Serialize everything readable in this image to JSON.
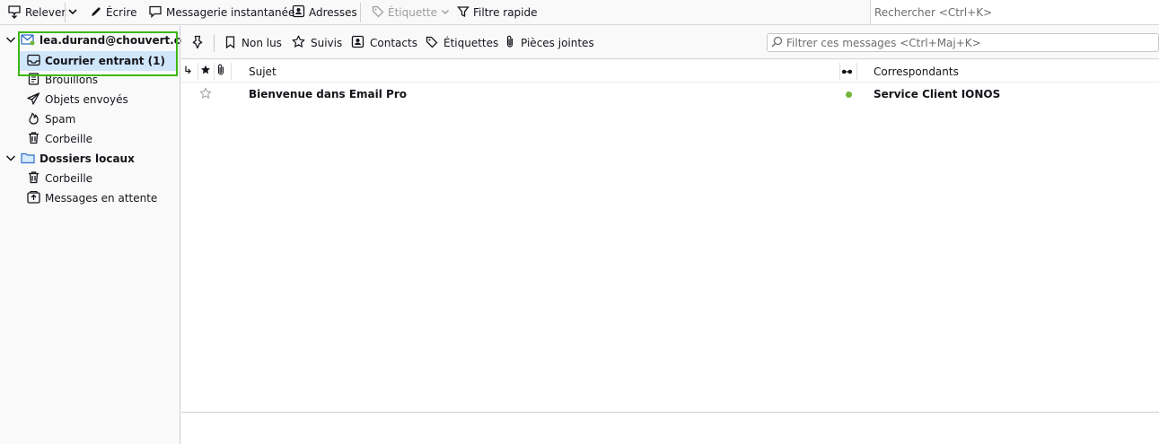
{
  "toolbar": {
    "get_messages": "Relever",
    "write": "Écrire",
    "chat": "Messagerie instantanée",
    "address_book": "Adresses",
    "tag": "Étiquette",
    "quick_filter": "Filtre rapide",
    "search_placeholder": "Rechercher <Ctrl+K>"
  },
  "folders": {
    "account": "lea.durand@chouvert.com",
    "inbox": "Courrier entrant (1)",
    "drafts": "Brouillons",
    "sent": "Objets envoyés",
    "spam": "Spam",
    "trash": "Corbeille",
    "local_folders": "Dossiers locaux",
    "local_trash": "Corbeille",
    "outbox": "Messages en attente"
  },
  "quick_filter_bar": {
    "unread": "Non lus",
    "starred": "Suivis",
    "contacts": "Contacts",
    "tags": "Étiquettes",
    "attachments": "Pièces jointes",
    "filter_placeholder": "Filtrer ces messages <Ctrl+Maj+K>"
  },
  "thread_header": {
    "subject": "Sujet",
    "correspondents": "Correspondants"
  },
  "messages": [
    {
      "subject": "Bienvenue dans Email Pro",
      "correspondent": "Service Client IONOS",
      "unread": true,
      "starred": false
    }
  ],
  "colors": {
    "selection": "#cfe6fb",
    "highlight_border": "#3cb815",
    "unread_dot": "#71b63b"
  }
}
